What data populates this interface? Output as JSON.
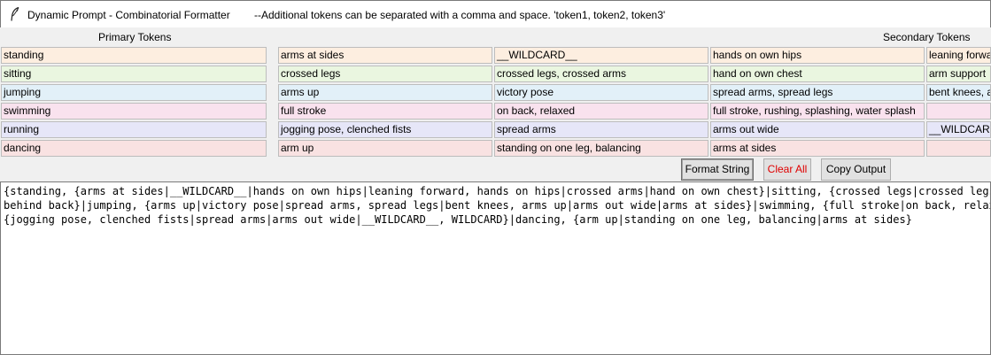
{
  "window": {
    "title": "Dynamic Prompt - Combinatorial Formatter",
    "subtitle": "--Additional tokens can be separated with a comma and space. 'token1, token2, token3'"
  },
  "headers": {
    "primary": "Primary Tokens",
    "secondary": "Secondary Tokens"
  },
  "rows": [
    {
      "color": "#fdeee0",
      "cells": [
        "standing",
        "arms at sides",
        "__WILDCARD__",
        "hands on own hips",
        "leaning forward, hands on hips"
      ]
    },
    {
      "color": "#eaf6e0",
      "cells": [
        "sitting",
        "crossed legs",
        "crossed legs, crossed arms",
        "hand on own chest",
        "arm support"
      ]
    },
    {
      "color": "#e2f0f8",
      "cells": [
        "jumping",
        "arms up",
        "victory pose",
        "spread arms, spread legs",
        "bent knees, arms up"
      ]
    },
    {
      "color": "#f9e2ee",
      "cells": [
        "swimming",
        "full stroke",
        "on back, relaxed",
        "full stroke, rushing, splashing, water splash",
        ""
      ]
    },
    {
      "color": "#e6e6f8",
      "cells": [
        "running",
        "jogging pose, clenched fists",
        "spread arms",
        "arms out wide",
        "__WILDCARD__"
      ]
    },
    {
      "color": "#f9e2e2",
      "cells": [
        "dancing",
        "arm up",
        "standing on one leg, balancing",
        "arms at sides",
        ""
      ]
    }
  ],
  "buttons": {
    "format": "Format String",
    "clear": "Clear All",
    "copy": "Copy Output"
  },
  "colors": {
    "clear_text": "#e00000"
  },
  "output": {
    "lines": [
      "{standing, {arms at sides|__WILDCARD__|hands on own hips|leaning forward, hands on hips|crossed arms|hand on own chest}|sitting, {crossed legs|crossed legs, crossed arms|arm support}|",
      "behind back}|jumping, {arms up|victory pose|spread arms, spread legs|bent knees, arms up|arms out wide|arms at sides}|swimming, {full stroke|on back, relaxed|full stroke, rushing, splashing, water splash}|running,",
      "{jogging pose, clenched fists|spread arms|arms out wide|__WILDCARD__, WILDCARD}|dancing, {arm up|standing on one leg, balancing|arms at sides}"
    ]
  }
}
